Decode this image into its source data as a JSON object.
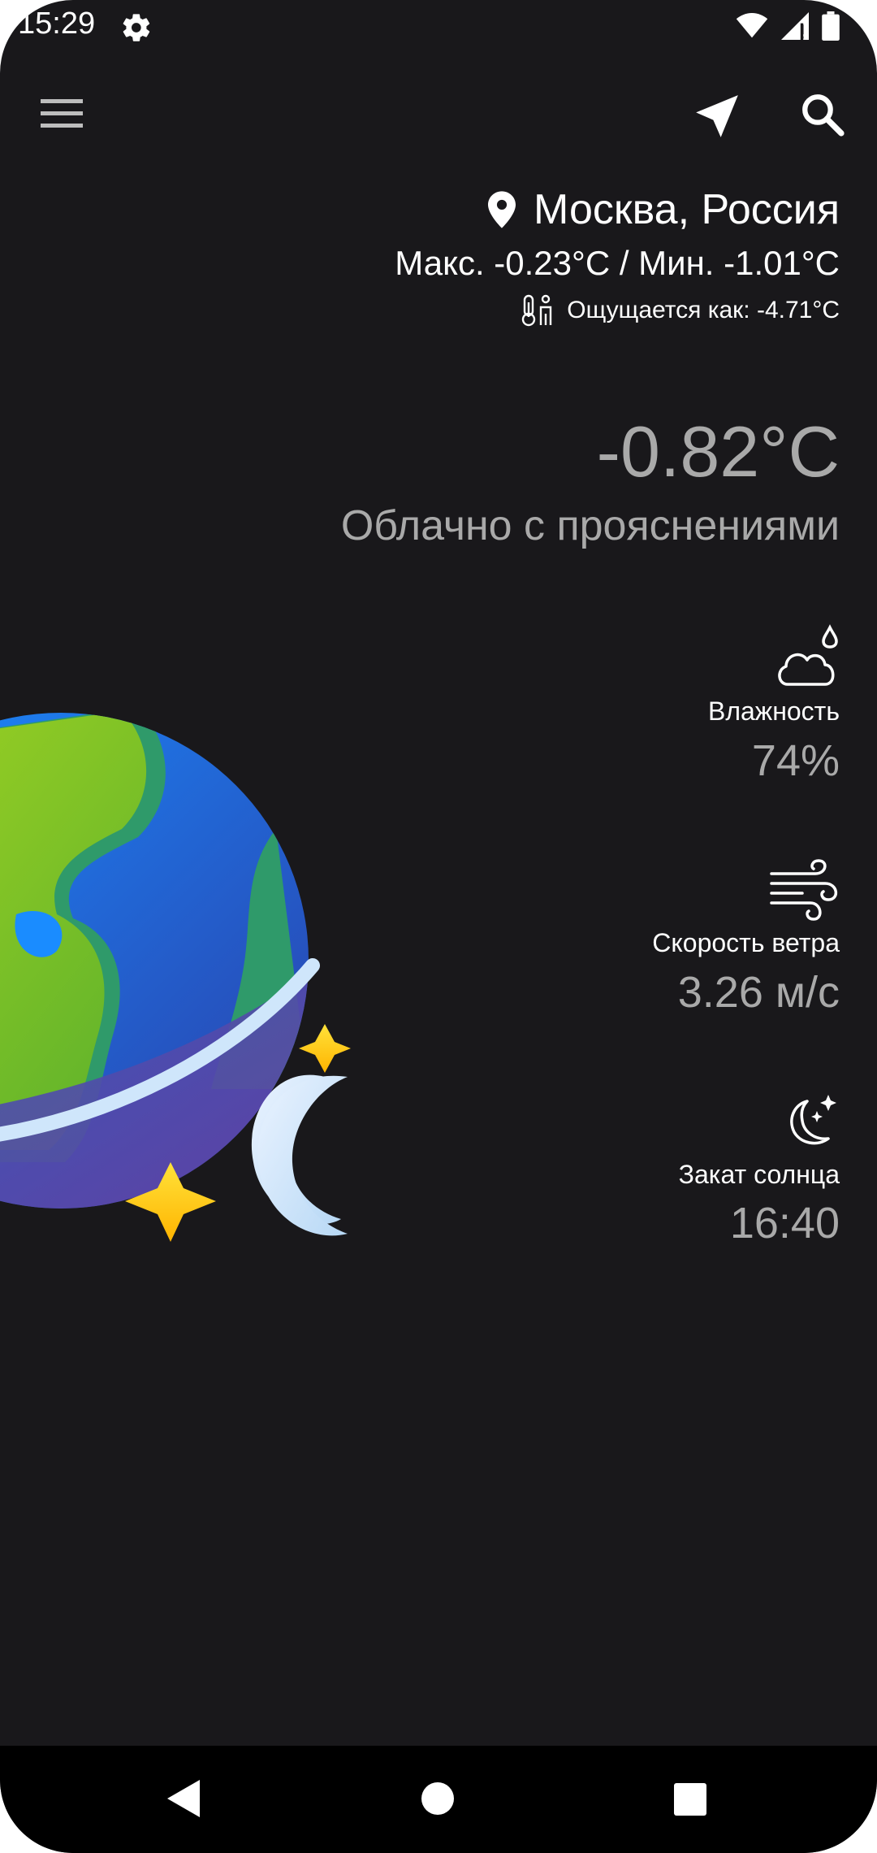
{
  "status_bar": {
    "time": "15:29",
    "icons": [
      "gear-icon",
      "wifi-icon",
      "signal-icon",
      "battery-icon"
    ]
  },
  "toolbar": {
    "icons": [
      "menu-icon",
      "location-arrow-icon",
      "search-icon"
    ]
  },
  "location": {
    "city": "Москва, Россия",
    "minmax": "Макс. -0.23°C / Мин. -1.01°C",
    "feels_like": "Ощущается как: -4.71°C"
  },
  "current": {
    "temperature": "-0.82°C",
    "description": "Облачно с прояснениями"
  },
  "stats": {
    "humidity": {
      "label": "Влажность",
      "value": "74%",
      "icon": "cloud-drop-icon"
    },
    "wind": {
      "label": "Скорость ветра",
      "value": "3.26 м/с",
      "icon": "wind-icon"
    },
    "sunset": {
      "label": "Закат солнца",
      "value": "16:40",
      "icon": "moon-stars-icon"
    }
  },
  "colors": {
    "background": "#19181b",
    "text_primary": "#ffffff",
    "text_secondary": "#a9a9a9",
    "nav_bar": "#000000"
  },
  "nav_bar": {
    "icons": [
      "back-icon",
      "home-icon",
      "recents-icon"
    ]
  }
}
